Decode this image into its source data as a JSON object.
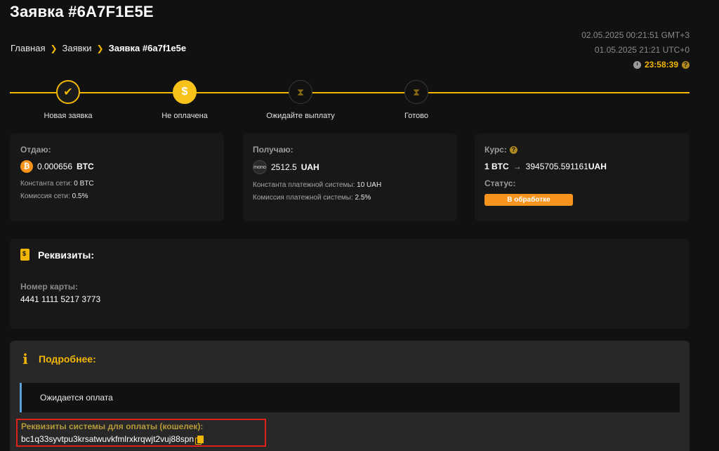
{
  "header": {
    "title": "Заявка #6A7F1E5E",
    "breadcrumb": [
      "Главная",
      "Заявки",
      "Заявка #6a7f1e5e"
    ],
    "time_local": "02.05.2025 00:21:51 GMT+3",
    "time_utc": "01.05.2025 21:21 UTC+0",
    "timer": "23:58:39"
  },
  "stepper": {
    "steps": [
      {
        "label": "Новая заявка",
        "state": "done",
        "icon": "check-icon"
      },
      {
        "label": "Не оплачена",
        "state": "active",
        "icon": "dollar-icon"
      },
      {
        "label": "Ожидайте выплату",
        "state": "pending",
        "icon": "hourglass-icon"
      },
      {
        "label": "Готово",
        "state": "pending",
        "icon": "hourglass-icon"
      }
    ]
  },
  "give": {
    "label": "Отдаю:",
    "amount": "0.000656",
    "currency": "BTC",
    "icon": "bitcoin-icon",
    "network_const_label": "Константа сети:",
    "network_const_value": "0 BTC",
    "network_fee_label": "Комиссия сети:",
    "network_fee_value": "0.5%"
  },
  "receive": {
    "label": "Получаю:",
    "amount": "2512.5",
    "currency": "UAH",
    "icon_text": "mono",
    "ps_const_label": "Константа платежной системы:",
    "ps_const_value": "10 UAH",
    "ps_fee_label": "Комиссия платежной системы:",
    "ps_fee_value": "2.5%"
  },
  "rate": {
    "label": "Курс:",
    "from": "1 BTC",
    "to_value": "3945705.591161",
    "to_currency": "UAH",
    "status_label": "Статус:",
    "status_value": "В обработке"
  },
  "requisites": {
    "title": "Реквизиты:",
    "card_label": "Номер карты:",
    "card_number": "4441 1111 5217 3773"
  },
  "details": {
    "title": "Подробнее:",
    "message": "Ожидается оплата",
    "wallet_label": "Реквизиты системы для оплаты (кошелек):",
    "wallet_address": "bc1q33syvtpu3krsatwuvkfmlrxkrqwjt2vuj88spn"
  },
  "colors": {
    "accent": "#f2b705",
    "status": "#f7941d",
    "background": "#111111",
    "highlight_border": "#e0201c"
  }
}
